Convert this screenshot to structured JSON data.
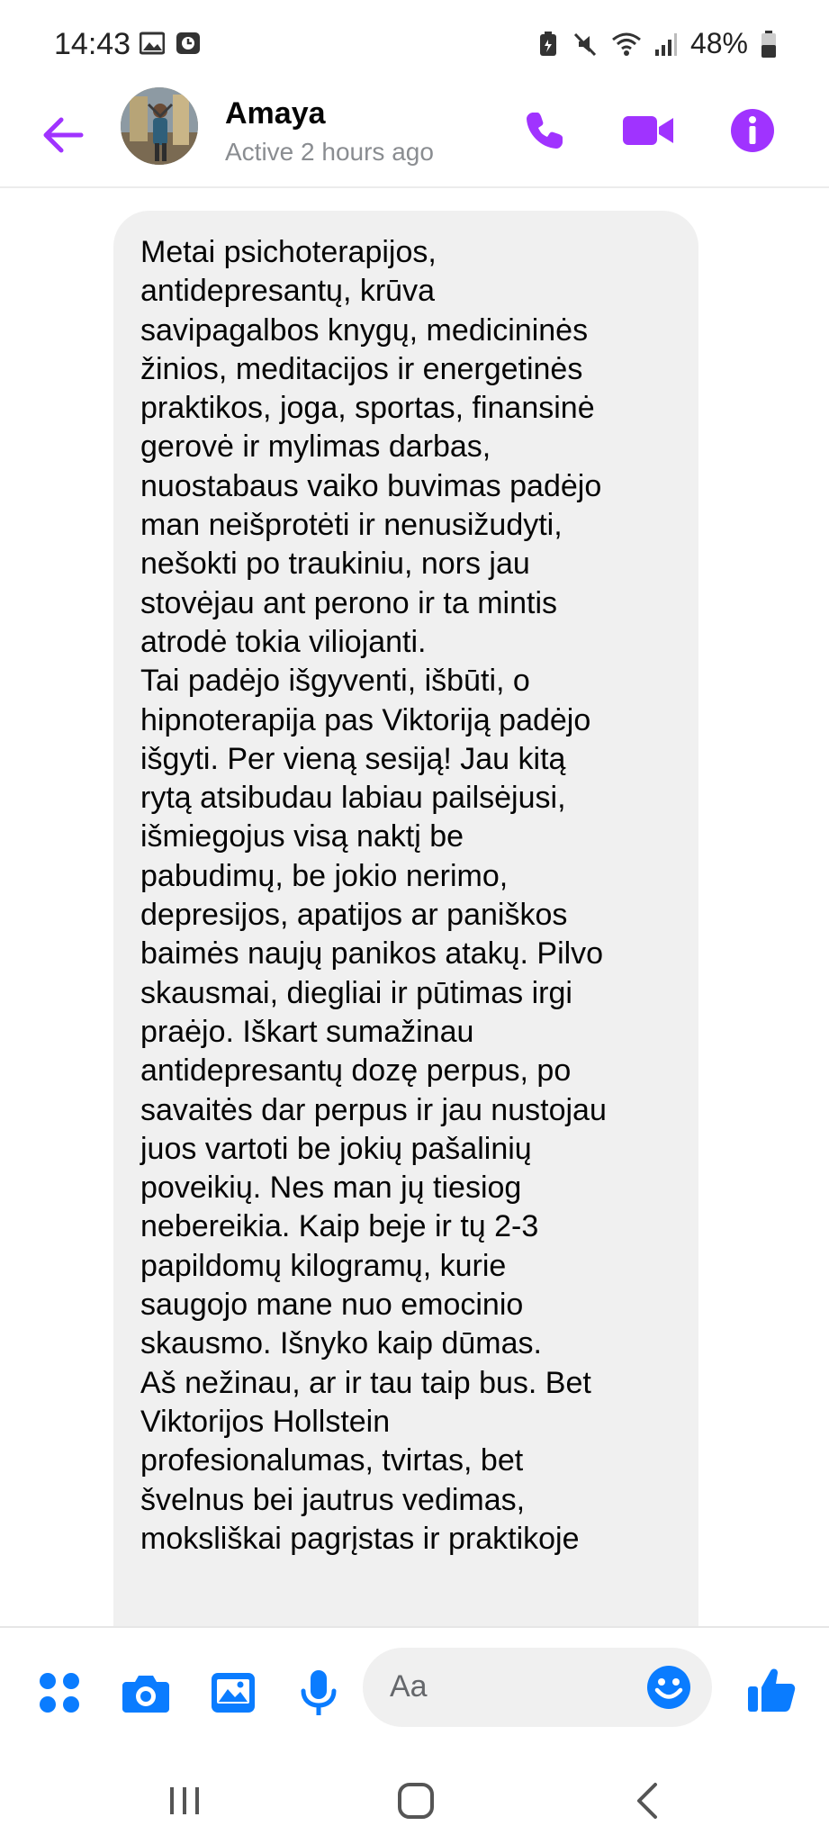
{
  "status_bar": {
    "time": "14:43",
    "battery": "48%"
  },
  "header": {
    "contact_name": "Amaya",
    "contact_status": "Active 2 hours ago"
  },
  "message": {
    "text": "Metai psichoterapijos,\nantidepresantų, krūva\nsavipagalbos knygų, medicininės\nžinios, meditacijos ir energetinės\npraktikos, joga, sportas, finansinė\ngerovė ir mylimas darbas,\nnuostabaus vaiko buvimas padėjo\nman neišprotėti ir nenusižudyti,\nnešokti po traukiniu, nors jau\nstovėjau ant perono ir ta mintis\natrodė tokia viliojanti.\nTai padėjo išgyventi, išbūti, o\nhipnoterapija pas Viktoriją padėjo\nišgyti. Per vieną sesiją! Jau kitą\nrytą atsibudau labiau pailsėjusi,\nišmiegojus visą naktį be\npabudimų, be jokio nerimo,\ndepresijos, apatijos ar paniškos\nbaimės naujų panikos atakų. Pilvo\nskausmai, diegliai ir pūtimas irgi\npraėjo. Iškart sumažinau\nantidepresantų dozę perpus, po\nsavaitės dar perpus ir jau nustojau\njuos vartoti be jokių pašalinių\npoveikių. Nes man jų tiesiog\nnebereikia. Kaip beje ir tų 2-3\npapildomų kilogramų, kurie\nsaugojo mane nuo emocinio\nskausmo. Išnyko kaip dūmas.\nAš nežinau, ar ir tau taip bus. Bet\nViktorijos Hollstein\nprofesionalumas, tvirtas, bet\nšvelnus bei jautrus vedimas,\nmoksliškai pagrįstas ir praktikoje"
  },
  "composer": {
    "placeholder": "Aa"
  },
  "icons": {
    "accent_color": "#a033ff",
    "composer_color": "#0a7cff",
    "back": "arrow-left-icon",
    "call": "phone-icon",
    "video": "video-camera-icon",
    "info": "info-icon",
    "menu": "four-dots-icon",
    "camera": "camera-icon",
    "gallery": "image-icon",
    "mic": "microphone-icon",
    "emoji": "emoji-icon",
    "like": "thumbs-up-icon"
  }
}
